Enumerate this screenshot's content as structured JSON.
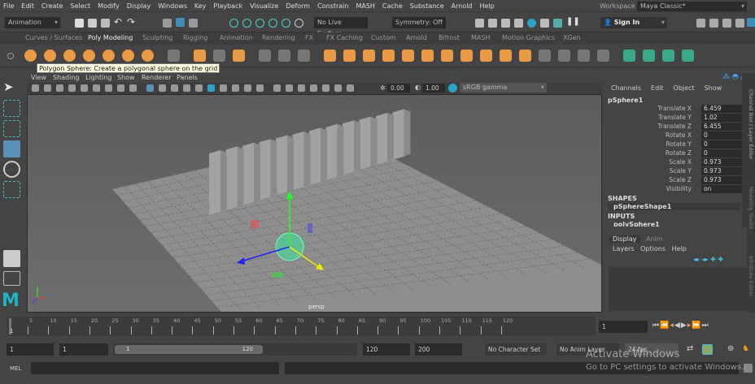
{
  "menubar": [
    "File",
    "Edit",
    "Create",
    "Select",
    "Modify",
    "Display",
    "Windows",
    "Key",
    "Playback",
    "Visualize",
    "Deform",
    "Constrain",
    "MASH",
    "Cache",
    "Substance",
    "Arnold",
    "Help"
  ],
  "workspace": {
    "label": "Workspace :",
    "value": "Maya Classic*"
  },
  "status": {
    "mode": "Animation",
    "live_surface": "No Live Surface",
    "symmetry": "Symmetry: Off",
    "sign_in": "Sign In"
  },
  "shelf_tabs": [
    "Curves / Surfaces",
    "Poly Modeling",
    "Sculpting",
    "Rigging",
    "Animation",
    "Rendering",
    "FX",
    "FX Caching",
    "Custom",
    "Arnold",
    "Bifrost",
    "MASH",
    "Motion Graphics",
    "XGen"
  ],
  "active_shelf": "Poly Modeling",
  "shelf_icons": [
    "poly-sphere-icon",
    "poly-cube-icon",
    "poly-cylinder-icon",
    "poly-cone-icon",
    "poly-torus-icon",
    "poly-diamond-icon",
    "poly-disc-icon",
    "platonic-icon",
    "sweep-icon",
    "type-icon",
    "svg-icon",
    "center-pivot-icon",
    "delete-history-icon",
    "freeze-transform-icon",
    "combine-icon",
    "separate-icon",
    "extract-icon",
    "bevel-icon",
    "bridge-icon",
    "extrude-icon",
    "append-icon",
    "smooth-icon",
    "boolean-icon",
    "mirror-icon",
    "fill-hole-icon",
    "target-weld-icon",
    "multi-cut-icon",
    "insert-loop-icon",
    "offset-loop-icon",
    "uv-planar-icon",
    "uv-cylindrical-icon",
    "uv-spherical-icon",
    "uv-auto-icon"
  ],
  "tooltip": "Polygon Sphere: Create a polygonal sphere on the grid",
  "viewport": {
    "menus": [
      "View",
      "Shading",
      "Lighting",
      "Show",
      "Renderer",
      "Panels"
    ],
    "exposure": "0.00",
    "gamma": "1.00",
    "color_space": "sRGB gamma",
    "camera": "persp"
  },
  "channel_box": {
    "menus": [
      "Channels",
      "Edit",
      "Object",
      "Show"
    ],
    "object": "pSphere1",
    "attributes": [
      {
        "name": "Translate X",
        "value": "6.459"
      },
      {
        "name": "Translate Y",
        "value": "1.02"
      },
      {
        "name": "Translate Z",
        "value": "6.455"
      },
      {
        "name": "Rotate X",
        "value": "0"
      },
      {
        "name": "Rotate Y",
        "value": "0"
      },
      {
        "name": "Rotate Z",
        "value": "0"
      },
      {
        "name": "Scale X",
        "value": "0.973"
      },
      {
        "name": "Scale Y",
        "value": "0.973"
      },
      {
        "name": "Scale Z",
        "value": "0.973"
      },
      {
        "name": "Visibility",
        "value": "on"
      }
    ],
    "shapes_label": "SHAPES",
    "shape": "pSphereShape1",
    "inputs_label": "INPUTS",
    "input": "polySphere1"
  },
  "layer_editor": {
    "tabs": [
      "Display",
      "Anim"
    ],
    "menus": [
      "Layers",
      "Options",
      "Help"
    ]
  },
  "side_tabs": [
    "Channel Box / Layer Editor",
    "Modeling Toolkit",
    "Attribute Editor"
  ],
  "timeline": {
    "ticks": [
      "5",
      "10",
      "15",
      "20",
      "25",
      "30",
      "35",
      "40",
      "45",
      "50",
      "55",
      "60",
      "65",
      "70",
      "75",
      "80",
      "85",
      "90",
      "95",
      "100",
      "105",
      "110",
      "115",
      "120"
    ],
    "start_marker": "1",
    "current_frame": "1"
  },
  "range": {
    "start": "1",
    "playback_start": "1",
    "slider_start": "1",
    "slider_end": "120",
    "playback_end": "120",
    "end": "200",
    "character_set": "No Character Set",
    "anim_layer": "No Anim Layer",
    "fps": "24 fps"
  },
  "mel": {
    "label": "MEL"
  },
  "watermark": {
    "title": "Activate Windows",
    "subtitle": "Go to PC settings to activate Windows."
  }
}
